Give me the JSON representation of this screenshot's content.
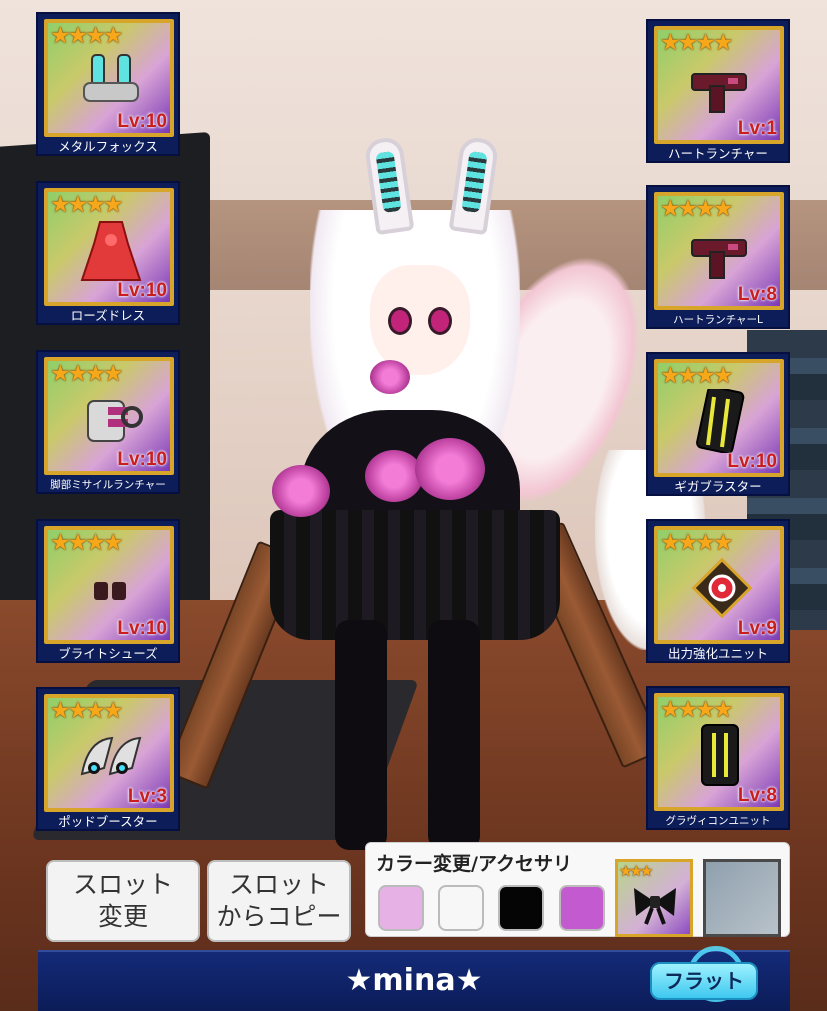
{
  "player_name": "★mina★",
  "stance_button": "フラット",
  "slot_change_button": "スロット\n変更",
  "slot_copy_button": "スロット\nからコピー",
  "color_panel": {
    "title": "カラー変更/アクセサリ",
    "swatches": [
      "#e6b2e6",
      "#f7f7f7",
      "#050505",
      "#c45ad0"
    ],
    "accessory_item_stars": "★★★",
    "accessory_item_icon": "bow-icon"
  },
  "colors": {
    "card_frame": "#d7a52a",
    "star": "#f6a71a",
    "level_text": "#c81e1e",
    "name_bar": "#142a78"
  },
  "left_slots": [
    {
      "name": "メタルフォックス",
      "stars": "★★★★",
      "level": "Lv:10",
      "icon": "fox-ear-headgear-icon"
    },
    {
      "name": "ローズドレス",
      "stars": "★★★★",
      "level": "Lv:10",
      "icon": "rose-dress-icon"
    },
    {
      "name": "脚部ミサイルランチャー",
      "stars": "★★★★",
      "level": "Lv:10",
      "icon": "leg-missile-launcher-icon"
    },
    {
      "name": "ブライトシューズ",
      "stars": "★★★★",
      "level": "Lv:10",
      "icon": "shoes-icon"
    },
    {
      "name": "ポッドブースター",
      "stars": "★★★★",
      "level": "Lv:3",
      "icon": "pod-booster-icon"
    }
  ],
  "right_slots": [
    {
      "name": "ハートランチャー",
      "stars": "★★★★",
      "level": "Lv:1",
      "icon": "heart-launcher-icon"
    },
    {
      "name": "ハートランチャーL",
      "stars": "★★★★",
      "level": "Lv:8",
      "icon": "heart-launcher-icon"
    },
    {
      "name": "ギガブラスター",
      "stars": "★★★★",
      "level": "Lv:10",
      "icon": "giga-blaster-icon"
    },
    {
      "name": "出力強化ユニット",
      "stars": "★★★★",
      "level": "Lv:9",
      "icon": "power-unit-icon"
    },
    {
      "name": "グラヴィコンユニット",
      "stars": "★★★★",
      "level": "Lv:8",
      "icon": "gravicon-unit-icon"
    }
  ]
}
